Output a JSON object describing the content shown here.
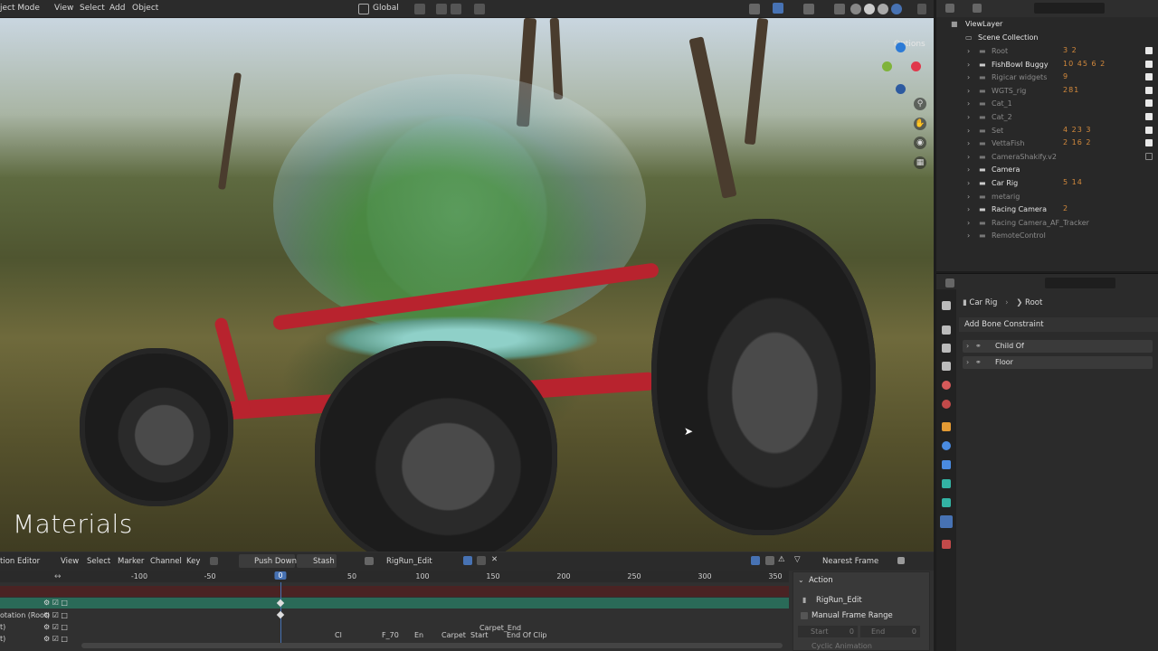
{
  "header": {
    "mode": "ject Mode",
    "menus": [
      "View",
      "Select",
      "Add",
      "Object"
    ],
    "orientation": "Global"
  },
  "viewport": {
    "overlay_text": "Materials",
    "options": "Options"
  },
  "outliner": {
    "view_layer": "ViewLayer",
    "scene_collection": "Scene Collection",
    "items": [
      {
        "name": "Root",
        "dim": true,
        "badges": "3  2",
        "checked": true
      },
      {
        "name": "FishBowl Buggy",
        "dim": false,
        "badges": "10  45  6  2",
        "checked": true
      },
      {
        "name": "Rigicar widgets",
        "dim": true,
        "badges": "9",
        "checked": true
      },
      {
        "name": "WGTS_rig",
        "dim": true,
        "badges": "281",
        "checked": true
      },
      {
        "name": "Cat_1",
        "dim": true,
        "badges": "",
        "checked": true
      },
      {
        "name": "Cat_2",
        "dim": true,
        "badges": "",
        "checked": true
      },
      {
        "name": "Set",
        "dim": true,
        "badges": "4  23  3",
        "checked": true
      },
      {
        "name": "VettaFish",
        "dim": true,
        "badges": "2  16  2",
        "checked": true
      },
      {
        "name": "CameraShakify.v2",
        "dim": true,
        "badges": "",
        "checked": false
      },
      {
        "name": "Camera",
        "dim": false,
        "badges": "",
        "checked": false
      },
      {
        "name": "Car Rig",
        "dim": false,
        "badges": "5  14",
        "checked": false
      },
      {
        "name": "metarig",
        "dim": true,
        "badges": "",
        "checked": false
      },
      {
        "name": "Racing Camera",
        "dim": false,
        "badges": "2",
        "checked": false
      },
      {
        "name": "Racing Camera_AF_Tracker",
        "dim": true,
        "badges": "",
        "checked": false
      },
      {
        "name": "RemoteControl",
        "dim": true,
        "badges": "",
        "checked": false
      }
    ]
  },
  "properties": {
    "breadcrumb_object": "Car Rig",
    "breadcrumb_bone": "Root",
    "add_constraint": "Add Bone Constraint",
    "constraints": [
      "Child Of",
      "Floor"
    ]
  },
  "timeline": {
    "editor": "tion Editor",
    "menus": [
      "View",
      "Select",
      "Marker",
      "Channel",
      "Key"
    ],
    "push_down": "Push Down",
    "stash": "Stash",
    "action_name": "RigRun_Edit",
    "snap": "Nearest Frame",
    "ticks": [
      "-100",
      "-50",
      "0",
      "50",
      "100",
      "150",
      "200",
      "250",
      "300",
      "350"
    ],
    "current_frame": "0",
    "channels": [
      "",
      "",
      "otation (Root)",
      "t)",
      "t)"
    ],
    "markers": [
      "Cl",
      "En",
      "F_70",
      "En",
      "Carpet",
      "Start",
      "End Of Clip"
    ],
    "marker_top": "Carpet_End"
  },
  "action_panel": {
    "title": "Action",
    "action_name": "RigRun_Edit",
    "manual_range": "Manual Frame Range",
    "start_label": "Start",
    "start_val": "0",
    "end_label": "End",
    "end_val": "0",
    "cyclic": "Cyclic Animation"
  }
}
